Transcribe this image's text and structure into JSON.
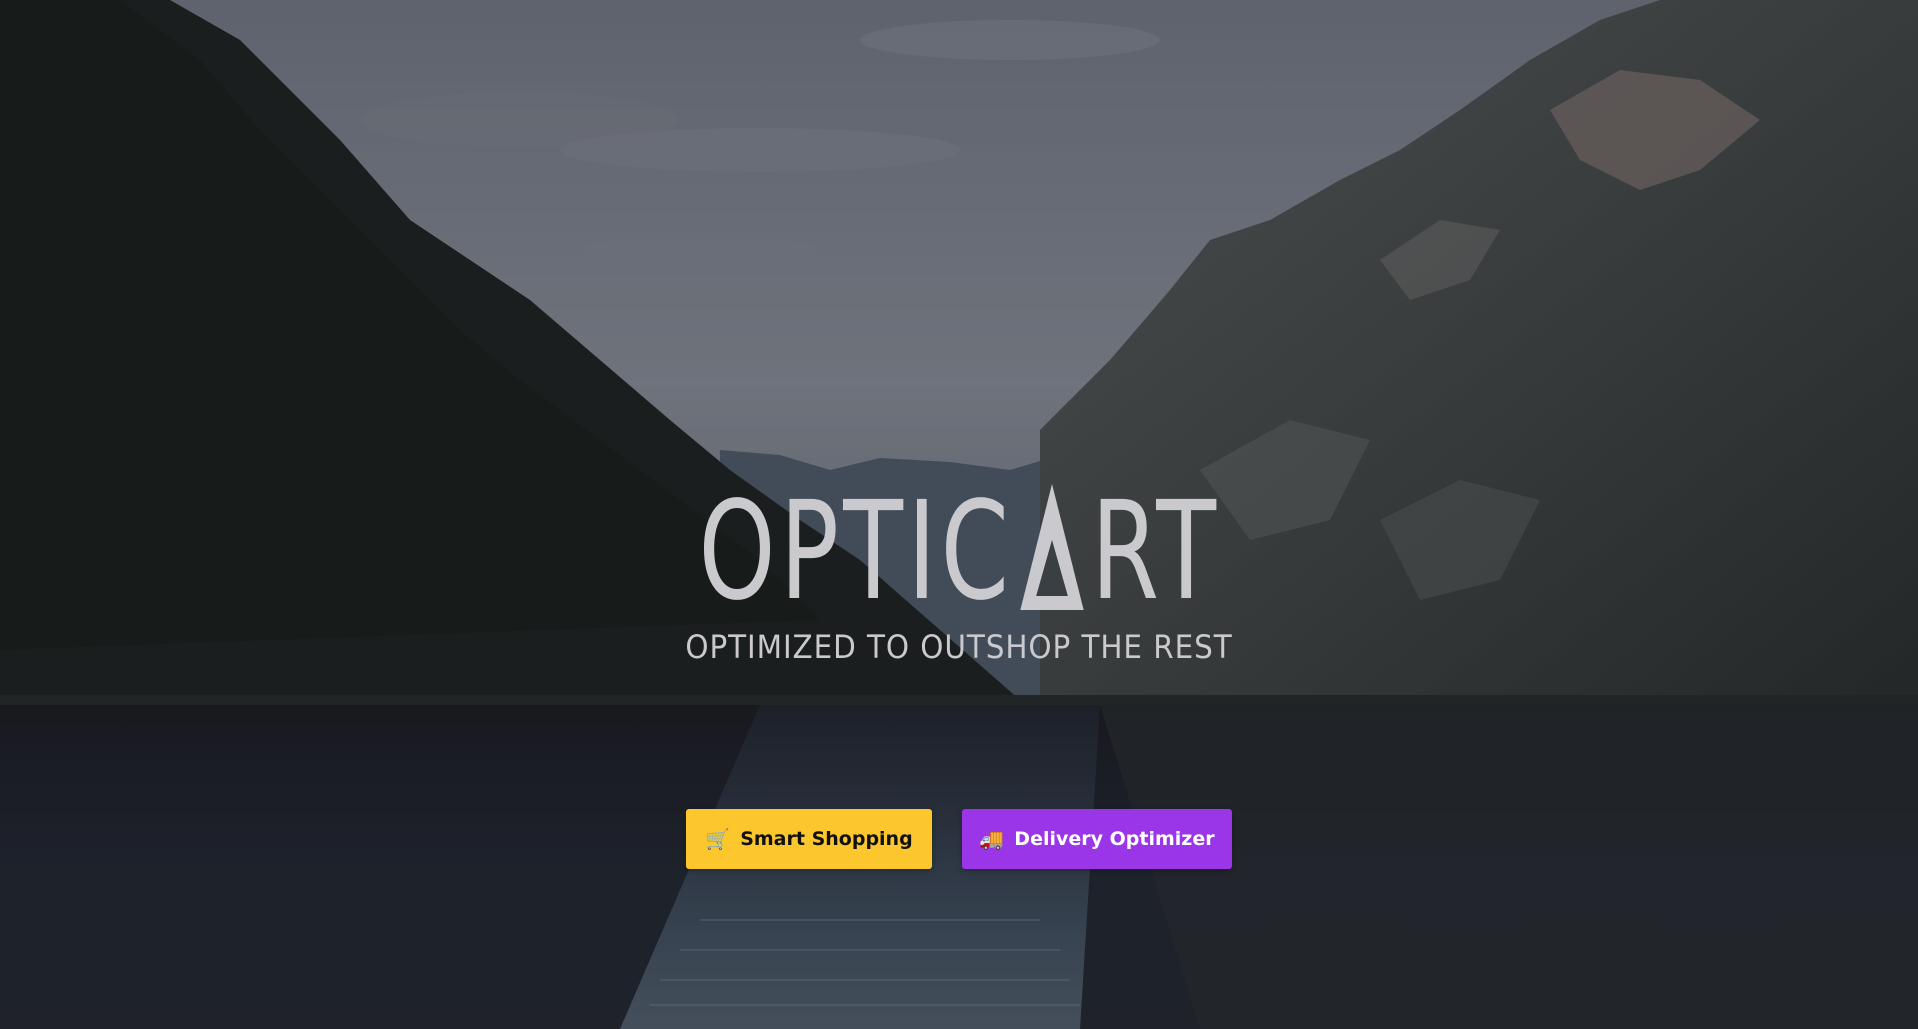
{
  "logo": {
    "before": "OPTIC",
    "after": "RT",
    "tagline": "OPTIMIZED TO OUTSHOP THE REST"
  },
  "buttons": {
    "shop": {
      "icon": "🛒",
      "label": "Smart Shopping",
      "bg": "#fcc62d"
    },
    "delivery": {
      "icon": "🚚",
      "label": "Delivery Optimizer",
      "bg": "#9b35e8"
    }
  },
  "background": {
    "scene": "lake-between-mountains-icon"
  }
}
